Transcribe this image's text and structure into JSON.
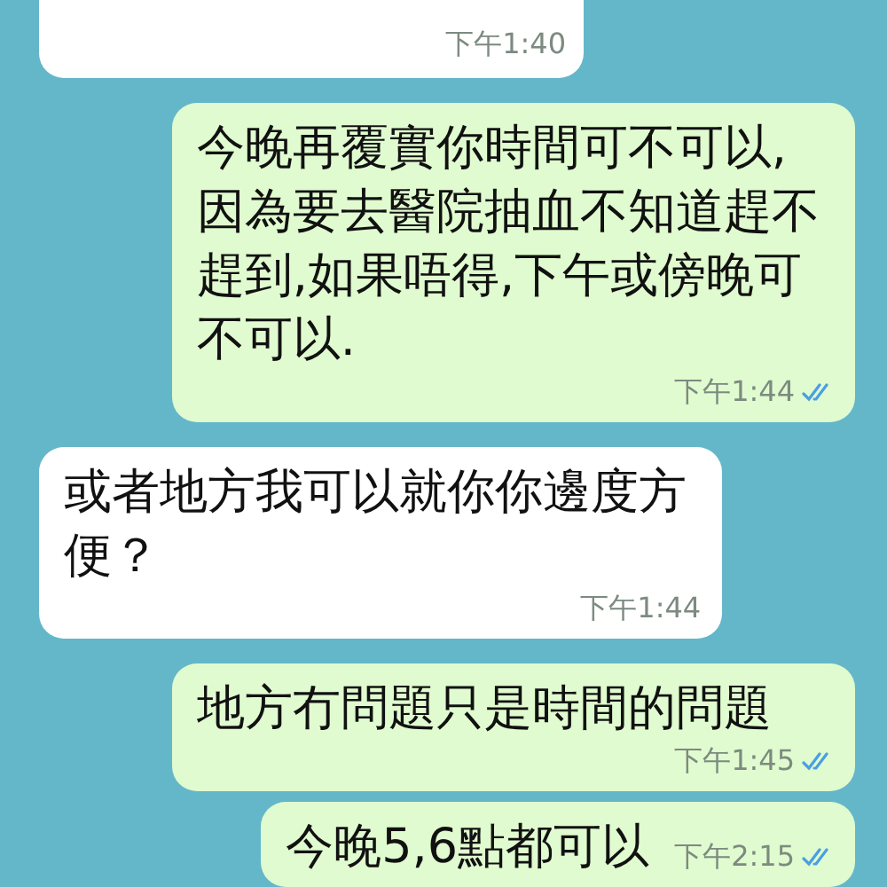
{
  "messages": [
    {
      "outgoing": false,
      "time": "下午1:40"
    },
    {
      "outgoing": true,
      "text": "今晚再覆實你時間可不可以,因為要去醫院抽血不知道趕不趕到,如果唔得,下午或傍晚可不可以.",
      "time": "下午1:44",
      "read": true
    },
    {
      "outgoing": false,
      "text": "或者地方我可以就你你邊度方便？",
      "time": "下午1:44"
    },
    {
      "outgoing": true,
      "text": "地方冇問題只是時間的問題",
      "time": "下午1:45",
      "read": true
    },
    {
      "outgoing": true,
      "text": "今晚5,6點都可以",
      "time": "下午2:15",
      "read": true
    }
  ]
}
